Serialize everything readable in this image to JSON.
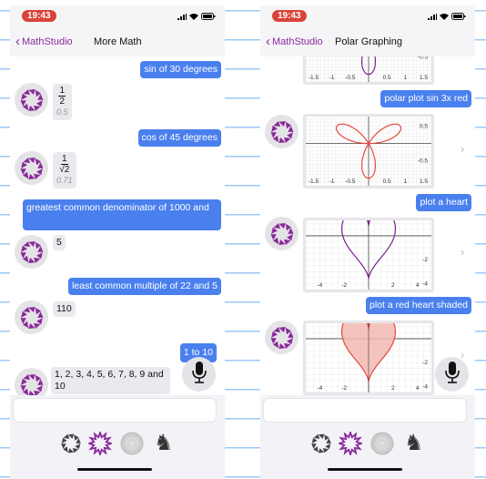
{
  "colors": {
    "accent": "#8a2a9b",
    "user_bubble": "#4a80ee",
    "status_time": "#d9443a",
    "plot_red": "#e8473c",
    "plot_purple": "#7b1f8f",
    "heart_fill": "#f2b8b2"
  },
  "left": {
    "status": {
      "time": "19:43"
    },
    "nav": {
      "back_label": "MathStudio",
      "title": "More Math"
    },
    "messages": {
      "u1": "sin of 30 degrees",
      "b1": {
        "num": "1",
        "den": "2",
        "decimal": "0.5"
      },
      "u2": "cos of 45 degrees",
      "b2": {
        "num": "1",
        "den": "√2",
        "decimal": "0.71"
      },
      "u3": "greatest common denominator of 1000 and",
      "b3": "5",
      "u4": "least common multiple of 22 and 5",
      "b4": "110",
      "u5": "1 to 10",
      "b5": "1, 2, 3, 4, 5, 6, 7, 8, 9 and 10"
    },
    "input": {
      "value": "",
      "placeholder": ""
    }
  },
  "right": {
    "status": {
      "time": "19:43"
    },
    "nav": {
      "back_label": "MathStudio",
      "title": "Polar Graphing"
    },
    "messages": {
      "u1": "polar plot sin 3x red",
      "u2": "plot a heart",
      "u3": "plot a red heart shaded"
    },
    "plots": [
      {
        "kind": "rose",
        "color": "#7b1f8f",
        "shaded": false,
        "x_ticks": [
          "-1.5",
          "-1",
          "-0.5",
          "0.5",
          "1",
          "1.5"
        ],
        "y_ticks": [
          "-0.5"
        ]
      },
      {
        "kind": "rose",
        "color": "#e8473c",
        "shaded": false,
        "x_ticks": [
          "-1.5",
          "-1",
          "-0.5",
          "0.5",
          "1",
          "1.5"
        ],
        "y_ticks": [
          "0.5",
          "-0.5"
        ]
      },
      {
        "kind": "heart",
        "color": "#7b1f8f",
        "shaded": false,
        "x_ticks": [
          "-4",
          "-2",
          "2",
          "4"
        ],
        "y_ticks": [
          "-2",
          "-4"
        ]
      },
      {
        "kind": "heart",
        "color": "#e8473c",
        "shaded": true,
        "x_ticks": [
          "-4",
          "-2",
          "2",
          "4"
        ],
        "y_ticks": [
          "-2",
          "-4"
        ]
      }
    ],
    "input": {
      "value": "",
      "placeholder": ""
    }
  },
  "icons": {
    "tabs": [
      "pinwheel-icon",
      "starburst-icon",
      "disc-icon",
      "llama-icon"
    ]
  }
}
